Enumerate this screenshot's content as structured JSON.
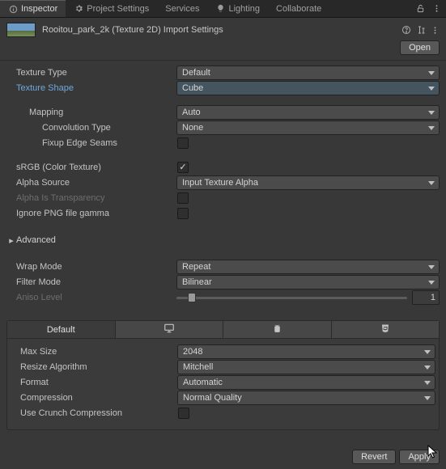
{
  "tabs": [
    "Inspector",
    "Project Settings",
    "Services",
    "Lighting",
    "Collaborate"
  ],
  "title": "Rooitou_park_2k (Texture 2D) Import Settings",
  "open_label": "Open",
  "fields": {
    "texture_type": {
      "label": "Texture Type",
      "value": "Default"
    },
    "texture_shape": {
      "label": "Texture Shape",
      "value": "Cube"
    },
    "mapping": {
      "label": "Mapping",
      "value": "Auto"
    },
    "convolution": {
      "label": "Convolution Type",
      "value": "None"
    },
    "fixup": {
      "label": "Fixup Edge Seams"
    },
    "srgb": {
      "label": "sRGB (Color Texture)"
    },
    "alpha_source": {
      "label": "Alpha Source",
      "value": "Input Texture Alpha"
    },
    "alpha_transparency": {
      "label": "Alpha Is Transparency"
    },
    "ignore_png": {
      "label": "Ignore PNG file gamma"
    },
    "advanced": {
      "label": "Advanced"
    },
    "wrap_mode": {
      "label": "Wrap Mode",
      "value": "Repeat"
    },
    "filter_mode": {
      "label": "Filter Mode",
      "value": "Bilinear"
    },
    "aniso": {
      "label": "Aniso Level",
      "value": "1"
    }
  },
  "platform_tabs": {
    "default": "Default"
  },
  "platform": {
    "max_size": {
      "label": "Max Size",
      "value": "2048"
    },
    "resize": {
      "label": "Resize Algorithm",
      "value": "Mitchell"
    },
    "format": {
      "label": "Format",
      "value": "Automatic"
    },
    "compression": {
      "label": "Compression",
      "value": "Normal Quality"
    },
    "crunch": {
      "label": "Use Crunch Compression"
    }
  },
  "footer": {
    "revert": "Revert",
    "apply": "Apply"
  }
}
